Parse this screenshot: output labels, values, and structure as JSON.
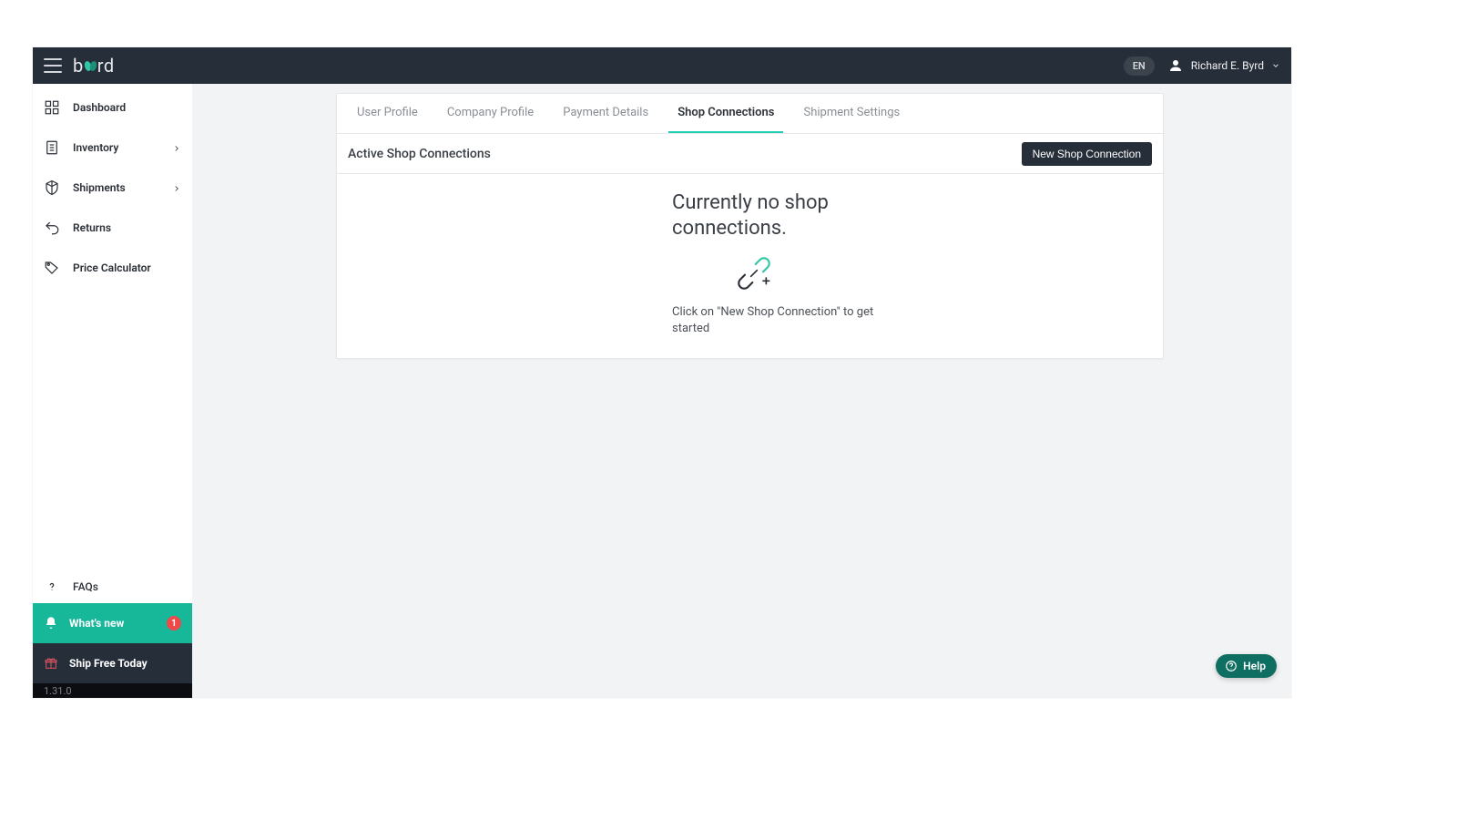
{
  "header": {
    "language": "EN",
    "user_name": "Richard E. Byrd",
    "logo_left": "b",
    "logo_right": "rd"
  },
  "sidebar": {
    "items": [
      {
        "label": "Dashboard",
        "has_chevron": false
      },
      {
        "label": "Inventory",
        "has_chevron": true
      },
      {
        "label": "Shipments",
        "has_chevron": true
      },
      {
        "label": "Returns",
        "has_chevron": false
      },
      {
        "label": "Price Calculator",
        "has_chevron": false
      }
    ],
    "faqs_label": "FAQs",
    "whatsnew_label": "What's new",
    "whatsnew_badge": "1",
    "shipfree_label": "Ship Free Today",
    "version": "1.31.0"
  },
  "tabs": {
    "items": [
      {
        "label": "User Profile",
        "active": false
      },
      {
        "label": "Company Profile",
        "active": false
      },
      {
        "label": "Payment Details",
        "active": false
      },
      {
        "label": "Shop Connections",
        "active": true
      },
      {
        "label": "Shipment Settings",
        "active": false
      }
    ]
  },
  "section": {
    "title": "Active Shop Connections",
    "new_button": "New Shop Connection"
  },
  "empty": {
    "title": "Currently no shop connections.",
    "subtitle": "Click on \"New Shop Connection\" to get started"
  },
  "help": {
    "label": "Help"
  }
}
